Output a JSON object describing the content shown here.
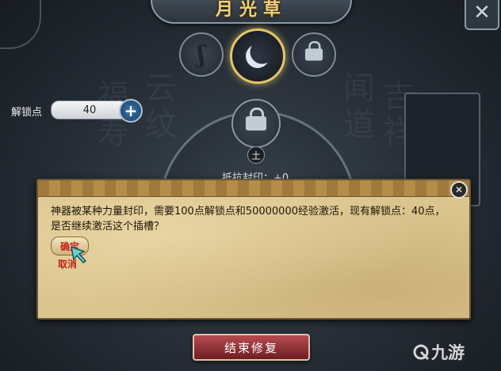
{
  "title": "月光草",
  "unlock": {
    "label": "解锁点",
    "value": "40"
  },
  "seal": {
    "earth_glyph": "土",
    "text": "抵抗封印：+0"
  },
  "dialog": {
    "message": "神器被某种力量封印，需要100点解锁点和50000000经验激活，现有解锁点：40点，是否继续激活这个插槽？",
    "confirm": "确定",
    "cancel": "取消"
  },
  "end_button": "结束修复",
  "watermark": "九游",
  "icons": {
    "tabs": [
      "hook-icon",
      "moon-icon",
      "lock-icon"
    ],
    "close": "close-icon",
    "add": "plus-icon"
  },
  "colors": {
    "title": "#f2d27a",
    "accent_active": "#e4c56a",
    "danger_text": "#c02414",
    "end_button": "#8e2a30"
  }
}
